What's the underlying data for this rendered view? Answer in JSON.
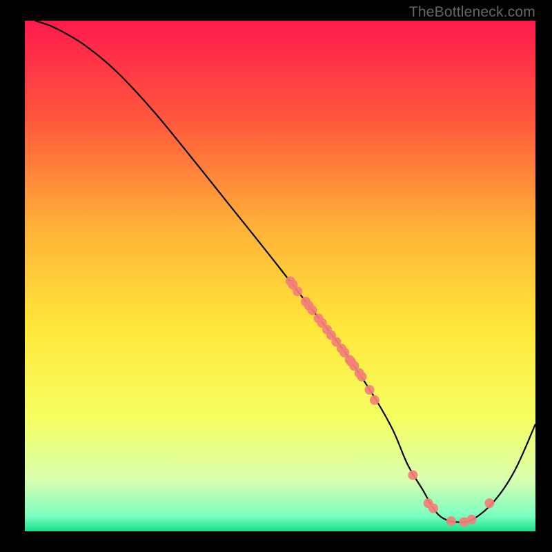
{
  "watermark": "TheBottleneck.com",
  "chart_data": {
    "type": "line",
    "title": "",
    "xlabel": "",
    "ylabel": "",
    "xlim": [
      0,
      100
    ],
    "ylim": [
      0,
      100
    ],
    "background_gradient": {
      "stops": [
        {
          "offset": 0,
          "color": "#ff1a4d"
        },
        {
          "offset": 20,
          "color": "#ff5a3c"
        },
        {
          "offset": 40,
          "color": "#ffb038"
        },
        {
          "offset": 60,
          "color": "#ffe73a"
        },
        {
          "offset": 78,
          "color": "#f5ff62"
        },
        {
          "offset": 90,
          "color": "#d8ffb0"
        },
        {
          "offset": 97,
          "color": "#7affc0"
        },
        {
          "offset": 100,
          "color": "#18e08a"
        }
      ]
    },
    "series": [
      {
        "name": "bottleneck-curve",
        "x": [
          2,
          5,
          8,
          12,
          18,
          25,
          32,
          40,
          48,
          55,
          62,
          68,
          72,
          75,
          78,
          80,
          82,
          85,
          88,
          92,
          96,
          100
        ],
        "y": [
          100,
          99,
          97.5,
          95,
          90,
          82.5,
          74,
          64,
          54,
          45,
          36,
          27,
          20,
          13,
          8,
          4.5,
          2.5,
          1.8,
          2.5,
          6,
          12,
          21
        ]
      }
    ],
    "markers": {
      "name": "data-points",
      "color": "#f47f78",
      "points": [
        {
          "x": 52,
          "y": 49
        },
        {
          "x": 52.5,
          "y": 48.3
        },
        {
          "x": 53.4,
          "y": 47
        },
        {
          "x": 55,
          "y": 45
        },
        {
          "x": 55.6,
          "y": 44.2
        },
        {
          "x": 56.3,
          "y": 43.3
        },
        {
          "x": 57.5,
          "y": 41.7
        },
        {
          "x": 58.2,
          "y": 40.8
        },
        {
          "x": 59.2,
          "y": 39.5
        },
        {
          "x": 60,
          "y": 38.4
        },
        {
          "x": 61,
          "y": 37.1
        },
        {
          "x": 62,
          "y": 35.8
        },
        {
          "x": 62.6,
          "y": 35
        },
        {
          "x": 63.6,
          "y": 33.6
        },
        {
          "x": 63.9,
          "y": 33.2
        },
        {
          "x": 64.5,
          "y": 32.4
        },
        {
          "x": 65.5,
          "y": 31
        },
        {
          "x": 66,
          "y": 30.3
        },
        {
          "x": 67.5,
          "y": 27.7
        },
        {
          "x": 68.5,
          "y": 25.7
        },
        {
          "x": 76,
          "y": 11
        },
        {
          "x": 79,
          "y": 5.5
        },
        {
          "x": 80,
          "y": 4.5
        },
        {
          "x": 83.5,
          "y": 2
        },
        {
          "x": 86,
          "y": 1.8
        },
        {
          "x": 87.5,
          "y": 2.3
        },
        {
          "x": 91,
          "y": 5.5
        }
      ]
    }
  }
}
